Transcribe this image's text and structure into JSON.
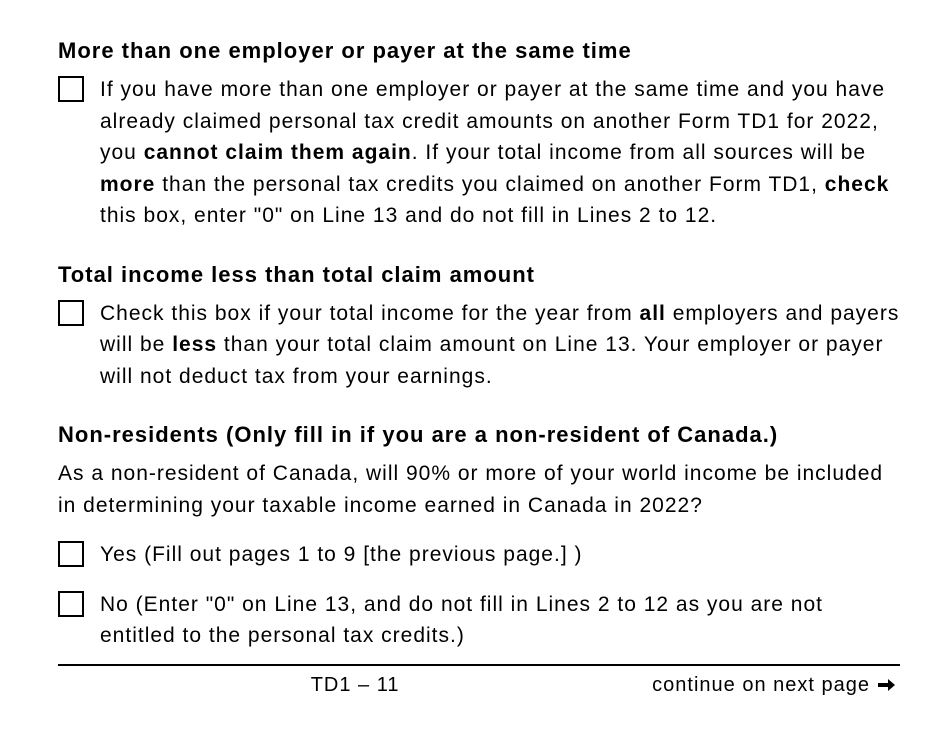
{
  "section1": {
    "heading": "More than one employer or payer at the same time",
    "text_parts": [
      "If you have more than one employer or payer at the same time and you have already claimed personal tax credit amounts on another Form TD1 for 2022, you ",
      "cannot claim them again",
      ". If your total income from all sources will be ",
      "more",
      " than the personal tax credits you claimed on another Form TD1, ",
      "check",
      " this box, enter \"0\" on Line 13 and do not fill in Lines 2 to 12."
    ]
  },
  "section2": {
    "heading": "Total income less than total claim amount",
    "text_parts": [
      "Check this box if your total income for the year from ",
      "all",
      " employers and payers will be ",
      "less",
      " than your total claim amount on Line 13. Your employer or payer will not deduct tax from your earnings."
    ]
  },
  "section3": {
    "heading": "Non-residents (Only fill in if you are a non-resident of Canada.)",
    "intro": "As a non-resident of Canada, will 90% or more of your world income be included in determining your taxable income earned in Canada in 2022?",
    "yes_text": "Yes (Fill out pages 1 to 9 [the previous page.] )",
    "no_text": "No (Enter \"0\" on Line 13, and do not fill in Lines 2 to 12 as you are not entitled to the personal tax credits.)"
  },
  "footer": {
    "page_label": "TD1 – 11",
    "continue_label": "continue on next page"
  }
}
